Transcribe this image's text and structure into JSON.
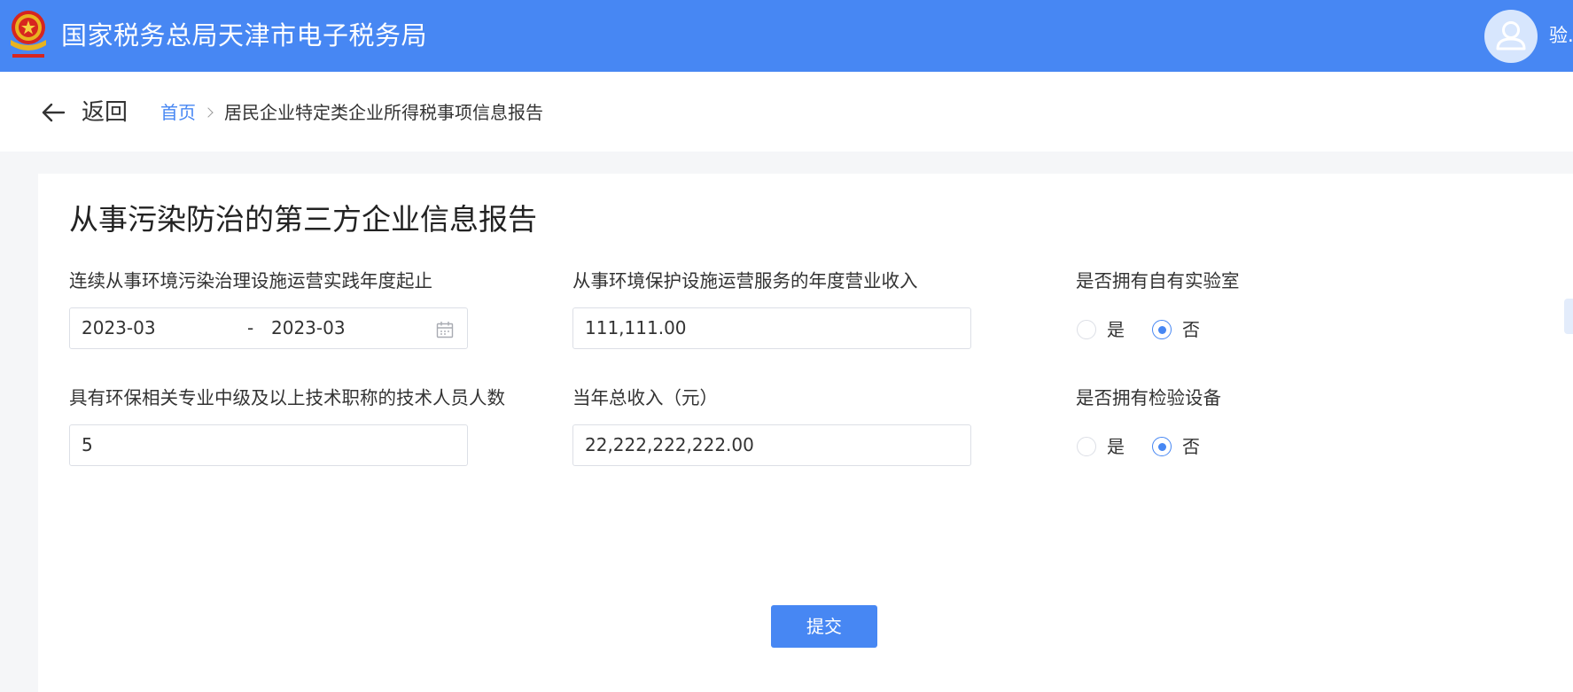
{
  "header": {
    "app_title": "国家税务总局天津市电子税务局",
    "username": "验."
  },
  "nav": {
    "back_label": "返回",
    "breadcrumb": {
      "home": "首页",
      "current": "居民企业特定类企业所得税事项信息报告"
    }
  },
  "form": {
    "title": "从事污染防治的第三方企业信息报告",
    "fields": {
      "period": {
        "label": "连续从事环境污染治理设施运营实践年度起止",
        "start": "2023-03",
        "separator": "-",
        "end": "2023-03",
        "icon": "calendar-icon"
      },
      "service_revenue": {
        "label": "从事环境保护设施运营服务的年度营业收入",
        "value": "111,111.00"
      },
      "own_lab": {
        "label": "是否拥有自有实验室",
        "options": [
          "是",
          "否"
        ],
        "selected": "否"
      },
      "tech_staff": {
        "label": "具有环保相关专业中级及以上技术职称的技术人员人数",
        "value": "5"
      },
      "total_income": {
        "label": "当年总收入（元）",
        "value": "22,222,222,222.00"
      },
      "own_equipment": {
        "label": "是否拥有检验设备",
        "options": [
          "是",
          "否"
        ],
        "selected": "否"
      }
    },
    "submit_label": "提交"
  },
  "colors": {
    "primary": "#4787f3",
    "background": "#f5f6f8",
    "border": "#dcdfe6"
  },
  "icons": [
    "emblem-icon",
    "user-avatar-icon",
    "back-arrow-icon",
    "breadcrumb-chevron-icon",
    "calendar-icon"
  ]
}
